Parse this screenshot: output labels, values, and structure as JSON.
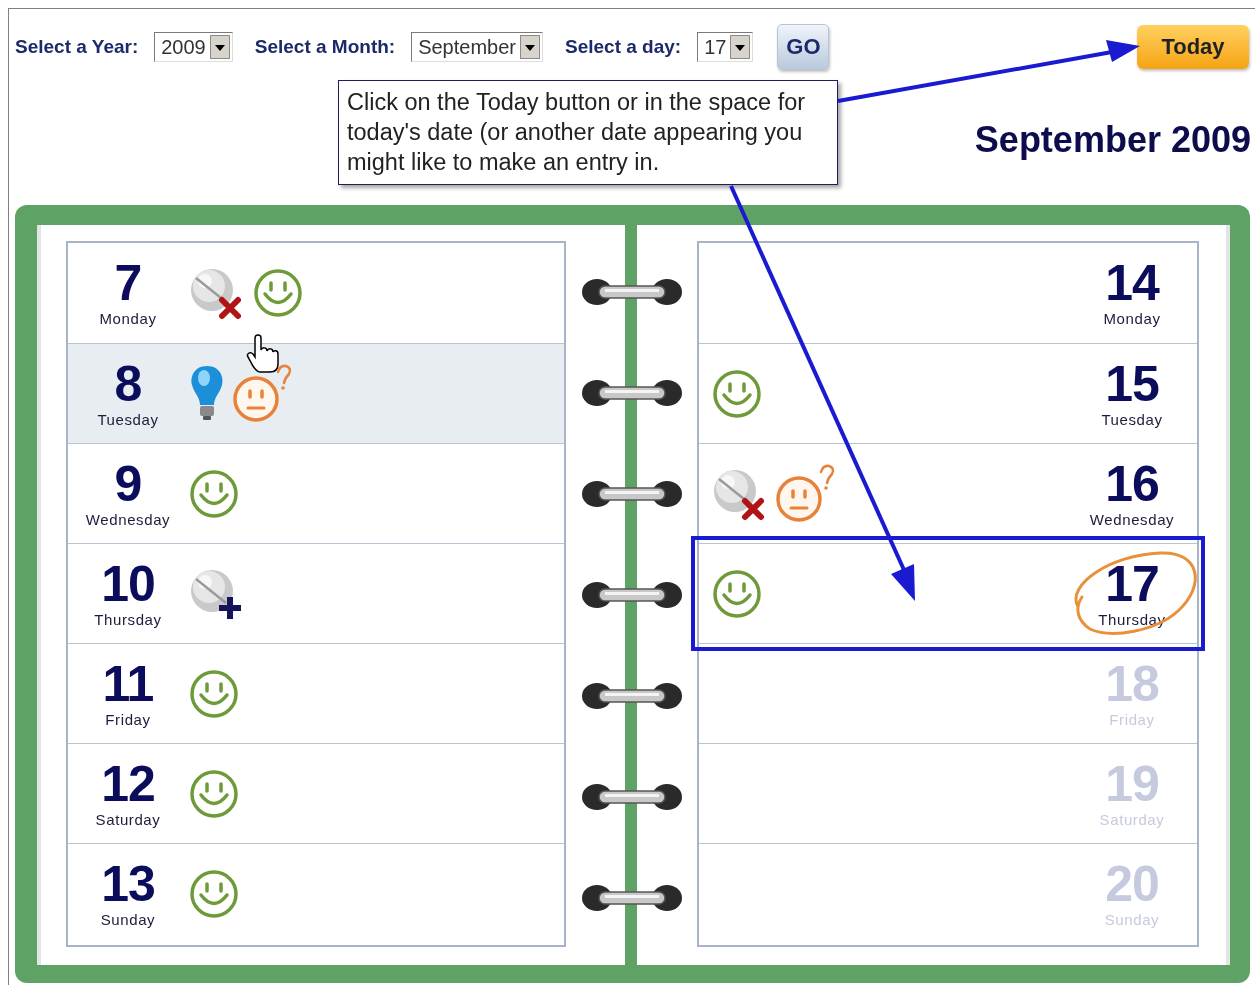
{
  "toolbar": {
    "selectors": [
      {
        "label": "Select a Year:",
        "value": "2009"
      },
      {
        "label": "Select a Month:",
        "value": "September"
      },
      {
        "label": "Select a day:",
        "value": "17"
      }
    ],
    "go_button": "GO",
    "today_button": "Today"
  },
  "callout": {
    "text": "Click on the Today button or in the space for today's date (or another date appearing you might like to make an entry in."
  },
  "title": "September 2009",
  "left_page": {
    "days": [
      {
        "number": "7",
        "weekday": "Monday",
        "selected": false,
        "highlighted": false,
        "dimmed": false,
        "icons": [
          {
            "kind": "pill-missed"
          },
          {
            "kind": "smiley"
          }
        ]
      },
      {
        "number": "8",
        "weekday": "Tuesday",
        "selected": false,
        "highlighted": true,
        "dimmed": false,
        "icons": [
          {
            "kind": "idea"
          },
          {
            "kind": "unsure"
          }
        ]
      },
      {
        "number": "9",
        "weekday": "Wednesday",
        "selected": false,
        "highlighted": false,
        "dimmed": false,
        "icons": [
          {
            "kind": "smiley"
          }
        ]
      },
      {
        "number": "10",
        "weekday": "Thursday",
        "selected": false,
        "highlighted": false,
        "dimmed": false,
        "icons": [
          {
            "kind": "pill-added"
          }
        ]
      },
      {
        "number": "11",
        "weekday": "Friday",
        "selected": false,
        "highlighted": false,
        "dimmed": false,
        "icons": [
          {
            "kind": "smiley"
          }
        ]
      },
      {
        "number": "12",
        "weekday": "Saturday",
        "selected": false,
        "highlighted": false,
        "dimmed": false,
        "icons": [
          {
            "kind": "smiley"
          }
        ]
      },
      {
        "number": "13",
        "weekday": "Sunday",
        "selected": false,
        "highlighted": false,
        "dimmed": false,
        "icons": [
          {
            "kind": "smiley"
          }
        ]
      }
    ]
  },
  "right_page": {
    "days": [
      {
        "number": "14",
        "weekday": "Monday",
        "selected": false,
        "highlighted": false,
        "dimmed": false
      },
      {
        "number": "15",
        "weekday": "Tuesday",
        "selected": false,
        "highlighted": false,
        "dimmed": false,
        "icons": [
          {
            "kind": "smiley"
          }
        ]
      },
      {
        "number": "16",
        "weekday": "Wednesday",
        "selected": false,
        "highlighted": false,
        "dimmed": false,
        "icons": [
          {
            "kind": "pill-missed"
          },
          {
            "kind": "unsure"
          }
        ]
      },
      {
        "number": "17",
        "weekday": "Thursday",
        "selected": true,
        "highlighted": false,
        "dimmed": false,
        "icons": [
          {
            "kind": "smiley"
          }
        ]
      },
      {
        "number": "18",
        "weekday": "Friday",
        "selected": false,
        "highlighted": false,
        "dimmed": true
      },
      {
        "number": "19",
        "weekday": "Saturday",
        "selected": false,
        "highlighted": false,
        "dimmed": true
      },
      {
        "number": "20",
        "weekday": "Sunday",
        "selected": false,
        "highlighted": false,
        "dimmed": true
      }
    ]
  }
}
